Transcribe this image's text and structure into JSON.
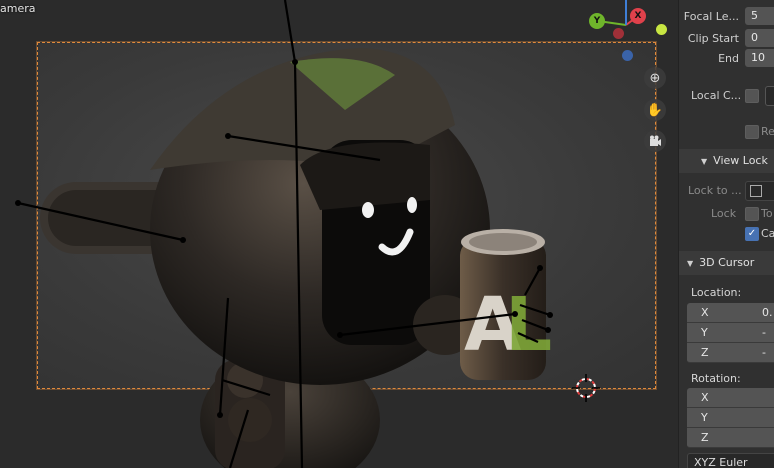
{
  "viewport": {
    "label": "amera",
    "gizmo": {
      "y": "Y",
      "x": "X"
    }
  },
  "sidebar": {
    "focal_length": {
      "label": "Focal Le...",
      "value": "5"
    },
    "clip_start": {
      "label": "Clip Start",
      "value": "0"
    },
    "clip_end": {
      "label": "End",
      "value": "10"
    },
    "local_camera": {
      "label": "Local C..."
    },
    "render_region": {
      "label": "Re"
    },
    "view_lock": {
      "title": "View Lock",
      "lock_to_object": {
        "label": "Lock to ..."
      },
      "lock": {
        "label": "Lock",
        "to_label": "To"
      },
      "camera_to_view": {
        "label": "Ca",
        "checked": true
      }
    },
    "cursor_3d": {
      "title": "3D Cursor",
      "location": {
        "label": "Location:",
        "x": "0.",
        "y": "-",
        "z": "-"
      },
      "rotation": {
        "label": "Rotation:",
        "x": "",
        "y": "",
        "z": ""
      },
      "rotation_mode": "XYZ Euler"
    },
    "axes": {
      "x": "X",
      "y": "Y",
      "z": "Z"
    }
  },
  "colors": {
    "camera_frame": "#e08a3c",
    "checkbox_on": "#4772b3",
    "gizmo_x": "#e0414b",
    "gizmo_y": "#6fb52b",
    "gizmo_z": "#3f7fd6"
  },
  "icons": [
    "zoom-icon",
    "hand-pan-icon",
    "camera-view-icon",
    "3d-cursor-icon",
    "lock-object-icon"
  ]
}
